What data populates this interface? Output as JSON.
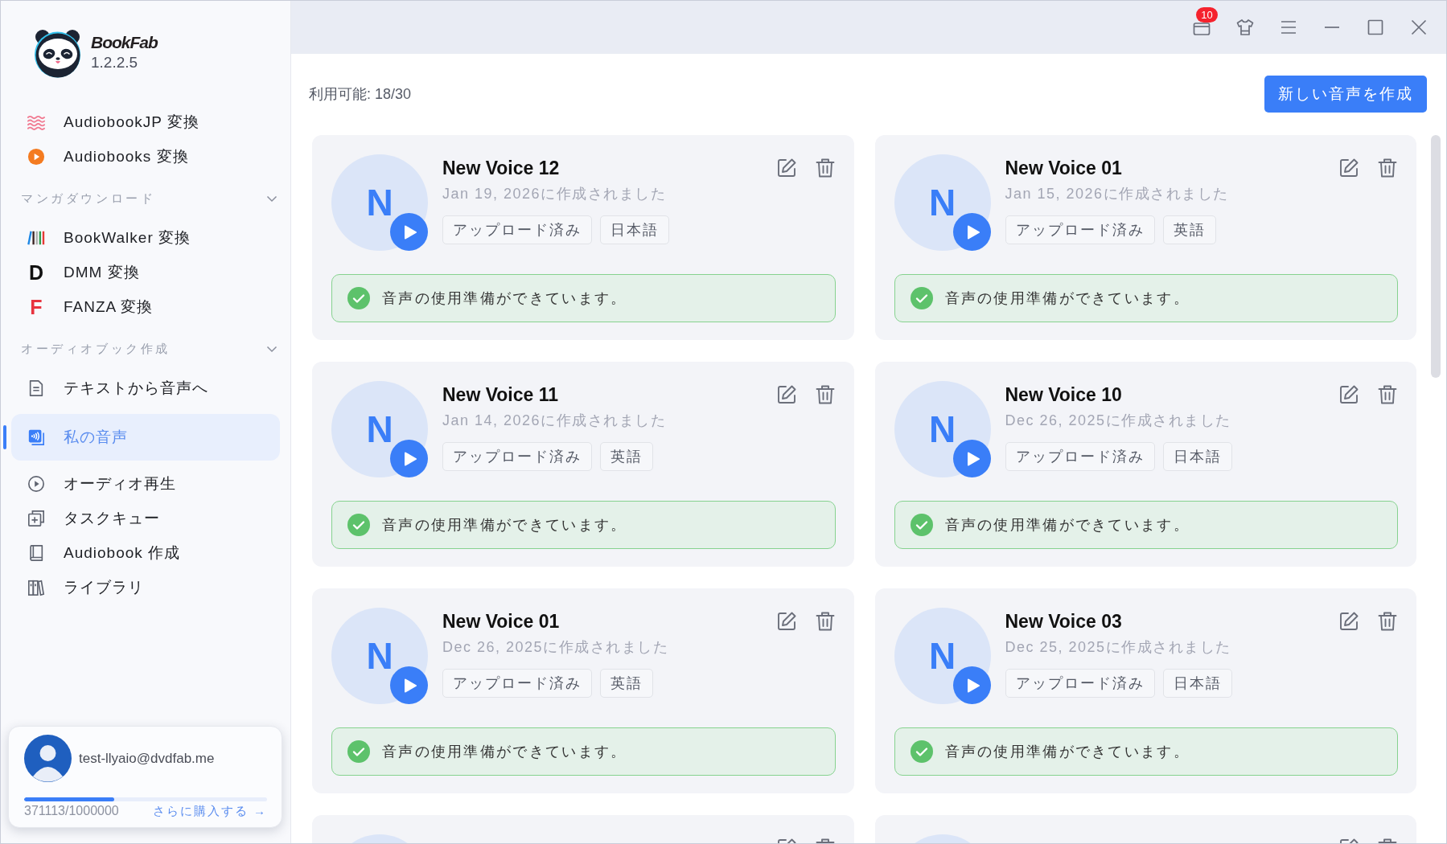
{
  "app": {
    "name": "BookFab",
    "version": "1.2.2.5"
  },
  "sidebar": {
    "groups": [
      {
        "items": [
          {
            "label": "AudiobookJP 変換",
            "kind": "icon",
            "selected": false
          },
          {
            "label": "Audiobooks 変換",
            "kind": "icon",
            "selected": false
          }
        ]
      },
      {
        "title": "マンガダウンロード",
        "expanded": true,
        "items": [
          {
            "label": "BookWalker 変換",
            "kind": "icon",
            "selected": false
          },
          {
            "label": "DMM 変換",
            "kind": "letter",
            "glyph": "D",
            "color": "#111111",
            "selected": false
          },
          {
            "label": "FANZA 変換",
            "kind": "letter",
            "glyph": "F",
            "color": "#e8343f",
            "selected": false
          }
        ]
      },
      {
        "title": "オーディオブック作成",
        "expanded": true,
        "items": [
          {
            "label": "テキストから音声へ",
            "kind": "icon",
            "selected": false
          },
          {
            "label": "私の音声",
            "kind": "icon",
            "selected": true
          },
          {
            "label": "オーディオ再生",
            "kind": "icon",
            "selected": false
          },
          {
            "label": "タスクキュー",
            "kind": "icon",
            "selected": false
          },
          {
            "label": "Audiobook 作成",
            "kind": "icon",
            "selected": false
          },
          {
            "label": "ライブラリ",
            "kind": "icon",
            "selected": false
          }
        ]
      }
    ]
  },
  "account": {
    "email": "test-llyaio@dvdfab.me",
    "level": 0.371,
    "usage": "371113/1000000",
    "buy_link": "さらに購入する →"
  },
  "title_bar": {
    "badge": "10"
  },
  "toolbar": {
    "available": "利用可能: 18/30",
    "create_button": "新しい音声を作成"
  },
  "voices": [
    {
      "kind": "full",
      "initial": "N",
      "name": "New Voice 12",
      "created": "Jan 19, 2026に作成されました",
      "tags": [
        "アップロード済み",
        "日本語"
      ],
      "status": "音声の使用準備ができています。"
    },
    {
      "kind": "full",
      "initial": "N",
      "name": "New Voice 01",
      "created": "Jan 15, 2026に作成されました",
      "tags": [
        "アップロード済み",
        "英語"
      ],
      "status": "音声の使用準備ができています。"
    },
    {
      "kind": "full",
      "initial": "N",
      "name": "New Voice 11",
      "created": "Jan 14, 2026に作成されました",
      "tags": [
        "アップロード済み",
        "英語"
      ],
      "status": "音声の使用準備ができています。"
    },
    {
      "kind": "full",
      "initial": "N",
      "name": "New Voice 10",
      "created": "Dec 26, 2025に作成されました",
      "tags": [
        "アップロード済み",
        "日本語"
      ],
      "status": "音声の使用準備ができています。"
    },
    {
      "kind": "full",
      "initial": "N",
      "name": "New Voice 01",
      "created": "Dec 26, 2025に作成されました",
      "tags": [
        "アップロード済み",
        "英語"
      ],
      "status": "音声の使用準備ができています。"
    },
    {
      "kind": "full",
      "initial": "N",
      "name": "New Voice 03",
      "created": "Dec 25, 2025に作成されました",
      "tags": [
        "アップロード済み",
        "日本語"
      ],
      "status": "音声の使用準備ができています。"
    },
    {
      "kind": "clipped"
    },
    {
      "kind": "clipped"
    }
  ]
}
